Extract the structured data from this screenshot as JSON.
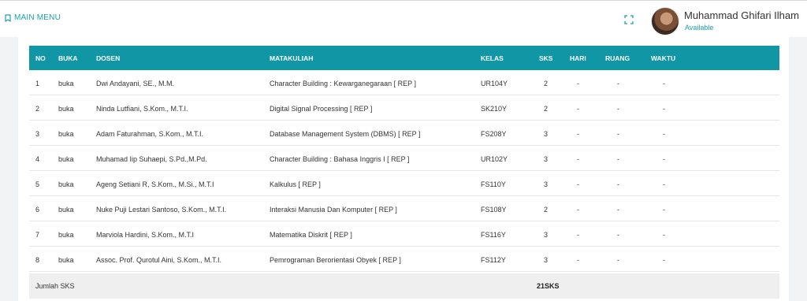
{
  "header": {
    "main_menu": "MAIN MENU",
    "user_name": "Muhammad Ghifari Ilham",
    "user_status": "Available"
  },
  "table": {
    "columns": [
      "NO",
      "BUKA",
      "DOSEN",
      "MATAKULIAH",
      "KELAS",
      "SKS",
      "HARI",
      "RUANG",
      "WAKTU"
    ],
    "rows": [
      {
        "no": "1",
        "buka": "buka",
        "dosen": "Dwi Andayani, SE., M.M.",
        "matakuliah": "Character Building : Kewarganegaraan [ REP ]",
        "kelas": "UR104Y",
        "sks": "2",
        "hari": "-",
        "ruang": "-",
        "waktu": "-"
      },
      {
        "no": "2",
        "buka": "buka",
        "dosen": "Ninda Lutfiani, S.Kom., M.T.I.",
        "matakuliah": "Digital Signal Processing [ REP ]",
        "kelas": "SK210Y",
        "sks": "2",
        "hari": "-",
        "ruang": "-",
        "waktu": "-"
      },
      {
        "no": "3",
        "buka": "buka",
        "dosen": "Adam Faturahman, S.Kom., M.T.I.",
        "matakuliah": "Database Management System (DBMS) [ REP ]",
        "kelas": "FS208Y",
        "sks": "3",
        "hari": "-",
        "ruang": "-",
        "waktu": "-"
      },
      {
        "no": "4",
        "buka": "buka",
        "dosen": "Muhamad Iip Suhaepi, S.Pd.,M.Pd.",
        "matakuliah": "Character Building : Bahasa Inggris I [ REP ]",
        "kelas": "UR102Y",
        "sks": "3",
        "hari": "-",
        "ruang": "-",
        "waktu": "-"
      },
      {
        "no": "5",
        "buka": "buka",
        "dosen": "Ageng Setiani R, S.Kom., M.Si., M.T.I",
        "matakuliah": "Kalkulus [ REP ]",
        "kelas": "FS110Y",
        "sks": "3",
        "hari": "-",
        "ruang": "-",
        "waktu": "-"
      },
      {
        "no": "6",
        "buka": "buka",
        "dosen": "Nuke Puji Lestari Santoso, S.Kom., M.T.I.",
        "matakuliah": "Interaksi Manusia Dan Komputer [ REP ]",
        "kelas": "FS108Y",
        "sks": "2",
        "hari": "-",
        "ruang": "-",
        "waktu": "-"
      },
      {
        "no": "7",
        "buka": "buka",
        "dosen": "Marviola Hardini, S.Kom., M.T.I",
        "matakuliah": "Matematika Diskrit [ REP ]",
        "kelas": "FS116Y",
        "sks": "3",
        "hari": "-",
        "ruang": "-",
        "waktu": "-"
      },
      {
        "no": "8",
        "buka": "buka",
        "dosen": "Assoc. Prof. Qurotul Aini, S.Kom., M.T.I.",
        "matakuliah": "Pemrograman Berorientasi Obyek [ REP ]",
        "kelas": "FS112Y",
        "sks": "3",
        "hari": "-",
        "ruang": "-",
        "waktu": "-"
      }
    ],
    "footer_label": "Jumlah SKS",
    "footer_total": "21SKS"
  },
  "colors": {
    "accent": "#1196a6",
    "link": "#1a9fb0",
    "footer_bg": "#efefef"
  }
}
